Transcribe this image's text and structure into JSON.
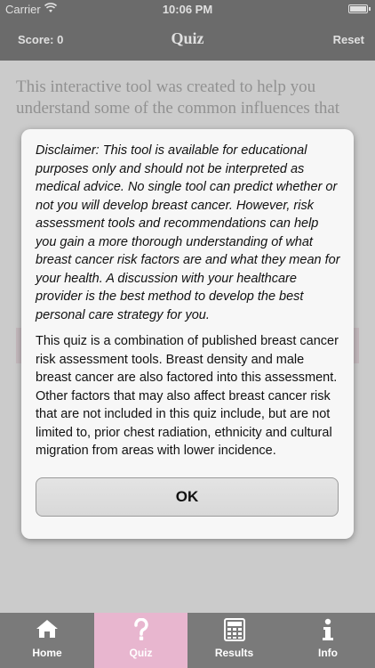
{
  "status_bar": {
    "carrier": "Carrier",
    "time": "10:06 PM"
  },
  "nav": {
    "score": "Score: 0",
    "title": "Quiz",
    "reset": "Reset"
  },
  "intro_text": "This interactive tool was created to help you understand some of the common influences that",
  "dialog": {
    "disclaimer": "Disclaimer: This tool is available for educational purposes only and should not be interpreted as medical advice. No single tool can predict whether or not you will develop breast cancer. However, risk assessment tools and recommendations can help you gain a more thorough understanding of what breast cancer risk factors are and what they mean for your health. A discussion with your healthcare provider is the best method to develop the best personal care strategy for you.",
    "description": "This quiz is a combination of published breast cancer risk assessment tools. Breast density and male breast cancer are also factored into this assessment. Other factors that may also affect breast cancer risk that are not included in this quiz include, but are not limited to, prior chest radiation, ethnicity and cultural migration from areas with lower incidence.",
    "ok_label": "OK"
  },
  "tabs": [
    {
      "label": "Home",
      "icon": "home-icon"
    },
    {
      "label": "Quiz",
      "icon": "question-icon"
    },
    {
      "label": "Results",
      "icon": "calculator-icon"
    },
    {
      "label": "Info",
      "icon": "info-icon"
    }
  ],
  "colors": {
    "bar": "#7a7a7a",
    "active_tab": "#e8b6cf",
    "dialog_bg": "#f7f7f7"
  },
  "battery_level": 1.0,
  "active_tab": "Quiz"
}
